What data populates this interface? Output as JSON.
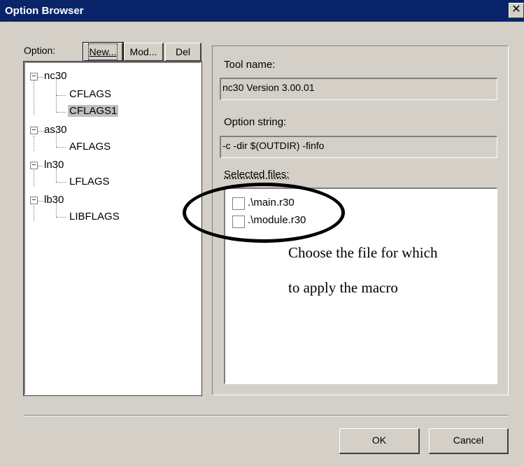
{
  "window": {
    "title": "Option Browser",
    "close_glyph": "✕"
  },
  "left_pane": {
    "option_label": "Option:",
    "buttons": {
      "new": "New...",
      "mod": "Mod...",
      "del": "Del"
    },
    "tree": [
      {
        "label": "nc30",
        "expander": "−",
        "children": [
          "CFLAGS",
          "CFLAGS1"
        ]
      },
      {
        "label": "as30",
        "expander": "−",
        "children": [
          "AFLAGS"
        ]
      },
      {
        "label": "ln30",
        "expander": "−",
        "children": [
          "LFLAGS"
        ]
      },
      {
        "label": "lb30",
        "expander": "−",
        "children": [
          "LIBFLAGS"
        ]
      }
    ],
    "selected_item": "CFLAGS1"
  },
  "right_pane": {
    "tool_name_label": "Tool name:",
    "tool_name_value": "nc30 Version 3.00.01",
    "option_string_label": "Option string:",
    "option_string_value": "-c -dir $(OUTDIR) -finfo",
    "selected_files_label": "Selected files:",
    "files": [
      ".\\main.r30",
      ".\\module.r30"
    ]
  },
  "annotation": {
    "line1": "Choose the file for which",
    "line2": "to apply the macro"
  },
  "footer": {
    "ok": "OK",
    "cancel": "Cancel"
  }
}
